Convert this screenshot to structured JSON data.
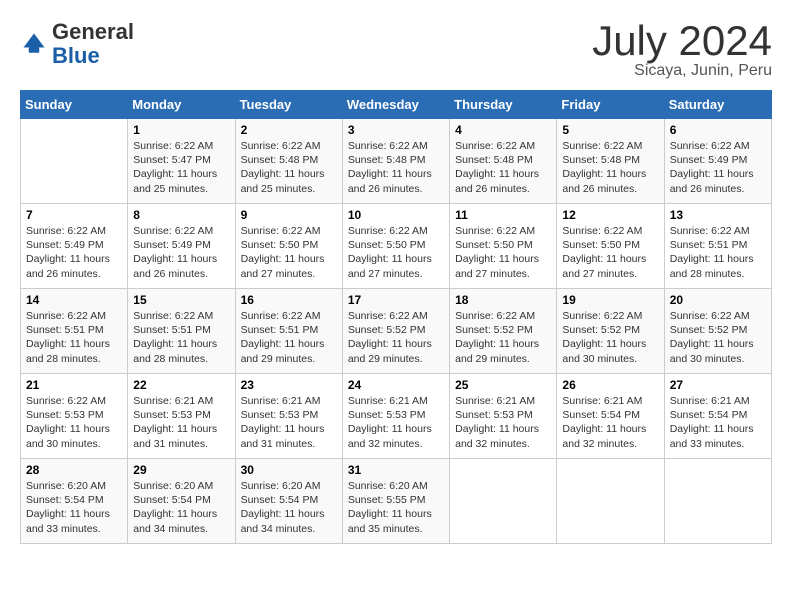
{
  "header": {
    "logo_general": "General",
    "logo_blue": "Blue",
    "month_year": "July 2024",
    "location": "Sicaya, Junin, Peru"
  },
  "days_of_week": [
    "Sunday",
    "Monday",
    "Tuesday",
    "Wednesday",
    "Thursday",
    "Friday",
    "Saturday"
  ],
  "weeks": [
    [
      {
        "day": "",
        "sunrise": "",
        "sunset": "",
        "daylight": ""
      },
      {
        "day": "1",
        "sunrise": "Sunrise: 6:22 AM",
        "sunset": "Sunset: 5:47 PM",
        "daylight": "Daylight: 11 hours and 25 minutes."
      },
      {
        "day": "2",
        "sunrise": "Sunrise: 6:22 AM",
        "sunset": "Sunset: 5:48 PM",
        "daylight": "Daylight: 11 hours and 25 minutes."
      },
      {
        "day": "3",
        "sunrise": "Sunrise: 6:22 AM",
        "sunset": "Sunset: 5:48 PM",
        "daylight": "Daylight: 11 hours and 26 minutes."
      },
      {
        "day": "4",
        "sunrise": "Sunrise: 6:22 AM",
        "sunset": "Sunset: 5:48 PM",
        "daylight": "Daylight: 11 hours and 26 minutes."
      },
      {
        "day": "5",
        "sunrise": "Sunrise: 6:22 AM",
        "sunset": "Sunset: 5:48 PM",
        "daylight": "Daylight: 11 hours and 26 minutes."
      },
      {
        "day": "6",
        "sunrise": "Sunrise: 6:22 AM",
        "sunset": "Sunset: 5:49 PM",
        "daylight": "Daylight: 11 hours and 26 minutes."
      }
    ],
    [
      {
        "day": "7",
        "sunrise": "Sunrise: 6:22 AM",
        "sunset": "Sunset: 5:49 PM",
        "daylight": "Daylight: 11 hours and 26 minutes."
      },
      {
        "day": "8",
        "sunrise": "Sunrise: 6:22 AM",
        "sunset": "Sunset: 5:49 PM",
        "daylight": "Daylight: 11 hours and 26 minutes."
      },
      {
        "day": "9",
        "sunrise": "Sunrise: 6:22 AM",
        "sunset": "Sunset: 5:50 PM",
        "daylight": "Daylight: 11 hours and 27 minutes."
      },
      {
        "day": "10",
        "sunrise": "Sunrise: 6:22 AM",
        "sunset": "Sunset: 5:50 PM",
        "daylight": "Daylight: 11 hours and 27 minutes."
      },
      {
        "day": "11",
        "sunrise": "Sunrise: 6:22 AM",
        "sunset": "Sunset: 5:50 PM",
        "daylight": "Daylight: 11 hours and 27 minutes."
      },
      {
        "day": "12",
        "sunrise": "Sunrise: 6:22 AM",
        "sunset": "Sunset: 5:50 PM",
        "daylight": "Daylight: 11 hours and 27 minutes."
      },
      {
        "day": "13",
        "sunrise": "Sunrise: 6:22 AM",
        "sunset": "Sunset: 5:51 PM",
        "daylight": "Daylight: 11 hours and 28 minutes."
      }
    ],
    [
      {
        "day": "14",
        "sunrise": "Sunrise: 6:22 AM",
        "sunset": "Sunset: 5:51 PM",
        "daylight": "Daylight: 11 hours and 28 minutes."
      },
      {
        "day": "15",
        "sunrise": "Sunrise: 6:22 AM",
        "sunset": "Sunset: 5:51 PM",
        "daylight": "Daylight: 11 hours and 28 minutes."
      },
      {
        "day": "16",
        "sunrise": "Sunrise: 6:22 AM",
        "sunset": "Sunset: 5:51 PM",
        "daylight": "Daylight: 11 hours and 29 minutes."
      },
      {
        "day": "17",
        "sunrise": "Sunrise: 6:22 AM",
        "sunset": "Sunset: 5:52 PM",
        "daylight": "Daylight: 11 hours and 29 minutes."
      },
      {
        "day": "18",
        "sunrise": "Sunrise: 6:22 AM",
        "sunset": "Sunset: 5:52 PM",
        "daylight": "Daylight: 11 hours and 29 minutes."
      },
      {
        "day": "19",
        "sunrise": "Sunrise: 6:22 AM",
        "sunset": "Sunset: 5:52 PM",
        "daylight": "Daylight: 11 hours and 30 minutes."
      },
      {
        "day": "20",
        "sunrise": "Sunrise: 6:22 AM",
        "sunset": "Sunset: 5:52 PM",
        "daylight": "Daylight: 11 hours and 30 minutes."
      }
    ],
    [
      {
        "day": "21",
        "sunrise": "Sunrise: 6:22 AM",
        "sunset": "Sunset: 5:53 PM",
        "daylight": "Daylight: 11 hours and 30 minutes."
      },
      {
        "day": "22",
        "sunrise": "Sunrise: 6:21 AM",
        "sunset": "Sunset: 5:53 PM",
        "daylight": "Daylight: 11 hours and 31 minutes."
      },
      {
        "day": "23",
        "sunrise": "Sunrise: 6:21 AM",
        "sunset": "Sunset: 5:53 PM",
        "daylight": "Daylight: 11 hours and 31 minutes."
      },
      {
        "day": "24",
        "sunrise": "Sunrise: 6:21 AM",
        "sunset": "Sunset: 5:53 PM",
        "daylight": "Daylight: 11 hours and 32 minutes."
      },
      {
        "day": "25",
        "sunrise": "Sunrise: 6:21 AM",
        "sunset": "Sunset: 5:53 PM",
        "daylight": "Daylight: 11 hours and 32 minutes."
      },
      {
        "day": "26",
        "sunrise": "Sunrise: 6:21 AM",
        "sunset": "Sunset: 5:54 PM",
        "daylight": "Daylight: 11 hours and 32 minutes."
      },
      {
        "day": "27",
        "sunrise": "Sunrise: 6:21 AM",
        "sunset": "Sunset: 5:54 PM",
        "daylight": "Daylight: 11 hours and 33 minutes."
      }
    ],
    [
      {
        "day": "28",
        "sunrise": "Sunrise: 6:20 AM",
        "sunset": "Sunset: 5:54 PM",
        "daylight": "Daylight: 11 hours and 33 minutes."
      },
      {
        "day": "29",
        "sunrise": "Sunrise: 6:20 AM",
        "sunset": "Sunset: 5:54 PM",
        "daylight": "Daylight: 11 hours and 34 minutes."
      },
      {
        "day": "30",
        "sunrise": "Sunrise: 6:20 AM",
        "sunset": "Sunset: 5:54 PM",
        "daylight": "Daylight: 11 hours and 34 minutes."
      },
      {
        "day": "31",
        "sunrise": "Sunrise: 6:20 AM",
        "sunset": "Sunset: 5:55 PM",
        "daylight": "Daylight: 11 hours and 35 minutes."
      },
      {
        "day": "",
        "sunrise": "",
        "sunset": "",
        "daylight": ""
      },
      {
        "day": "",
        "sunrise": "",
        "sunset": "",
        "daylight": ""
      },
      {
        "day": "",
        "sunrise": "",
        "sunset": "",
        "daylight": ""
      }
    ]
  ]
}
